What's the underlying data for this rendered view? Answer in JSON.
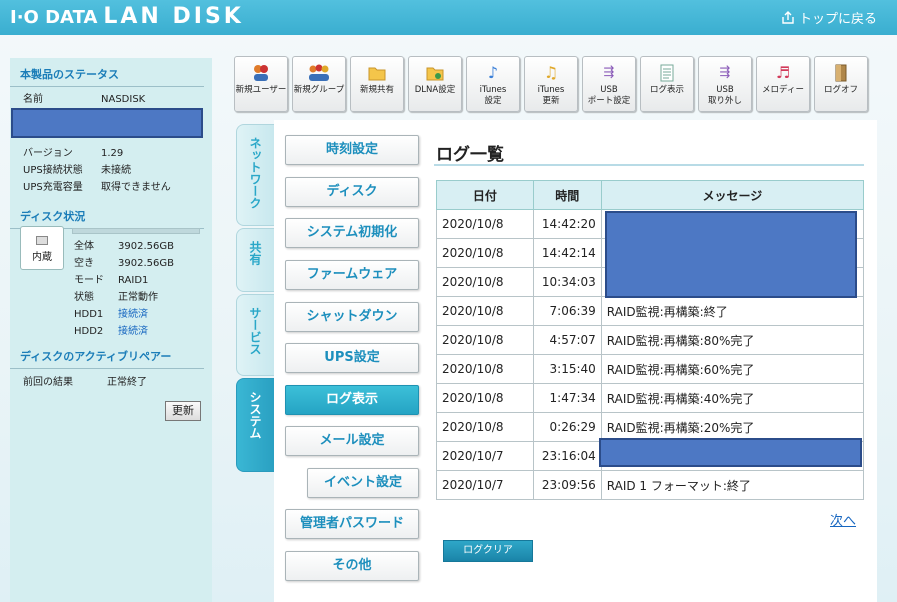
{
  "header": {
    "brand_io": "I·O DATA",
    "brand_lan": "LAN DISK",
    "back_link": "トップに戻る"
  },
  "status": {
    "title": "本製品のステータス",
    "name_label": "名前",
    "name_value": "NASDISK",
    "version_label": "バージョン",
    "version_value": "1.29",
    "ups_label": "UPS接続状態",
    "ups_value": "未接続",
    "ups_cap_label": "UPS充電容量",
    "ups_cap_value": "取得できません"
  },
  "disk": {
    "title": "ディスク状況",
    "icon_label": "内蔵",
    "usage_fraction": 0.0,
    "rows": [
      {
        "k": "全体",
        "v": "3902.56GB"
      },
      {
        "k": "空き",
        "v": "3902.56GB"
      },
      {
        "k": "モード",
        "v": "RAID1"
      },
      {
        "k": "状態",
        "v": "正常動作"
      },
      {
        "k": "HDD1",
        "v": "接続済"
      },
      {
        "k": "HDD2",
        "v": "接続済"
      }
    ]
  },
  "active_repair": {
    "title": "ディスクのアクティブリペアー",
    "result_label": "前回の結果",
    "result_value": "正常終了",
    "refresh": "更新"
  },
  "toolbar": [
    {
      "icon": "new-user-icon",
      "label": "新規ユーザー"
    },
    {
      "icon": "new-group-icon",
      "label": "新規グループ"
    },
    {
      "icon": "new-share-icon",
      "label": "新規共有"
    },
    {
      "icon": "dlna-icon",
      "label": "DLNA設定"
    },
    {
      "icon": "itunes-settings-icon",
      "label": "iTunes\n設定"
    },
    {
      "icon": "itunes-update-icon",
      "label": "iTunes\n更新"
    },
    {
      "icon": "usb-port-icon",
      "label": "USB\nポート設定"
    },
    {
      "icon": "log-view-icon",
      "label": "ログ表示"
    },
    {
      "icon": "usb-remove-icon",
      "label": "USB\n取り外し"
    },
    {
      "icon": "melody-icon",
      "label": "メロディー"
    },
    {
      "icon": "logoff-icon",
      "label": "ログオフ"
    }
  ],
  "tabs": {
    "network": "ネットワーク",
    "share": "共有",
    "service": "サービス",
    "system": "システム"
  },
  "submenu": [
    "時刻設定",
    "ディスク",
    "システム初期化",
    "ファームウェア",
    "シャットダウン",
    "UPS設定",
    "ログ表示",
    "メール設定",
    "イベント設定",
    "管理者パスワード",
    "その他"
  ],
  "log": {
    "title": "ログ一覧",
    "columns": [
      "日付",
      "時間",
      "メッセージ"
    ],
    "rows": [
      {
        "date": "2020/10/8",
        "time": "14:42:20",
        "msg": ""
      },
      {
        "date": "2020/10/8",
        "time": "14:42:14",
        "msg": ""
      },
      {
        "date": "2020/10/8",
        "time": "10:34:03",
        "msg": ""
      },
      {
        "date": "2020/10/8",
        "time": "7:06:39",
        "msg": "RAID監視:再構築:終了"
      },
      {
        "date": "2020/10/8",
        "time": "4:57:07",
        "msg": "RAID監視:再構築:80%完了"
      },
      {
        "date": "2020/10/8",
        "time": "3:15:40",
        "msg": "RAID監視:再構築:60%完了"
      },
      {
        "date": "2020/10/8",
        "time": "1:47:34",
        "msg": "RAID監視:再構築:40%完了"
      },
      {
        "date": "2020/10/8",
        "time": "0:26:29",
        "msg": "RAID監視:再構築:20%完了"
      },
      {
        "date": "2020/10/7",
        "time": "23:16:04",
        "msg": ""
      },
      {
        "date": "2020/10/7",
        "time": "23:09:56",
        "msg": "RAID 1 フォーマット:終了"
      }
    ],
    "next": "次へ",
    "clear": "ログクリア"
  },
  "colors": {
    "header": "#3aaed0",
    "accent": "#25a4c4",
    "redaction": "#4d78c4"
  }
}
